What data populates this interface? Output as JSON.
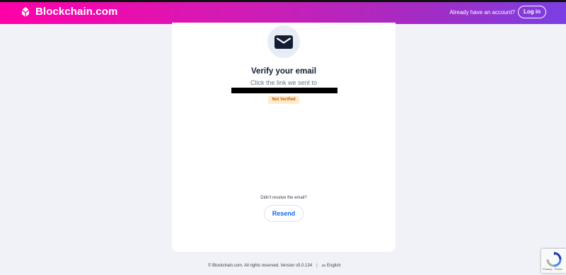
{
  "header": {
    "brand": "Blockchain.com",
    "account_prompt": "Already have an account?",
    "login_label": "Log in"
  },
  "card": {
    "icon": "envelope-icon",
    "title": "Verify your email",
    "subtitle": "Click the link we sent to",
    "status_badge": "Not Verified",
    "resend_prompt": "Didn't receive the email?",
    "resend_label": "Resend"
  },
  "footer": {
    "copyright": "© Blockchain.com. All rights reserved. Version v5.0.134",
    "separator": "|",
    "lang_code": "us",
    "lang_label": "English"
  },
  "recaptcha": {
    "text": "Privacy - Terms"
  },
  "colors": {
    "header_gradient_start": "#ff00a8",
    "header_gradient_end": "#7b3fe4",
    "link_blue": "#0c6cf2",
    "badge_bg": "#ffeccc",
    "badge_text": "#c25e05",
    "page_bg": "#f0f2f7"
  }
}
